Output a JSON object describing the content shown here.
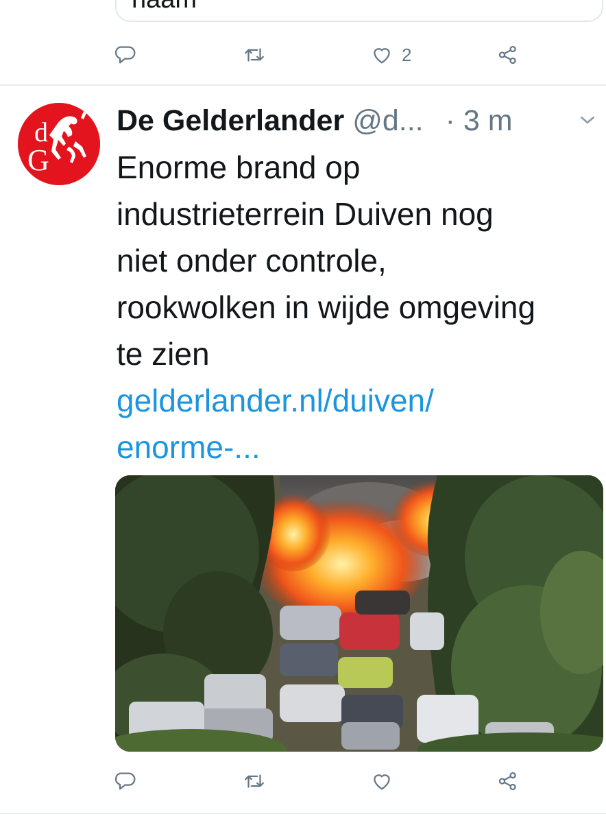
{
  "previous_tweet": {
    "input_text": "haam",
    "actions": {
      "reply_icon": "reply-icon",
      "retweet_icon": "retweet-icon",
      "like_icon": "heart-icon",
      "like_count": "2",
      "share_icon": "share-icon"
    }
  },
  "tweet": {
    "author_name": "De Gelderlander",
    "author_handle": "@d...",
    "time": "· 3 m",
    "avatar": {
      "letters_top": "d",
      "letters_bottom": "G",
      "brand_color": "#e3141d"
    },
    "text_lines": [
      "Enorme brand op",
      "industrieterrein Duiven nog",
      "niet onder controle,",
      "rookwolken in wijde omgeving",
      "te zien"
    ],
    "link_lines": [
      "gelderlander.nl/duiven/",
      "enorme-..."
    ],
    "link_color": "#1b95e0",
    "media": {
      "kind": "photo"
    },
    "actions": {
      "reply_icon": "reply-icon",
      "retweet_icon": "retweet-icon",
      "like_icon": "heart-icon",
      "share_icon": "share-icon"
    }
  },
  "colors": {
    "text": "#14171a",
    "secondary": "#657786",
    "divider": "#e6ecf0"
  }
}
